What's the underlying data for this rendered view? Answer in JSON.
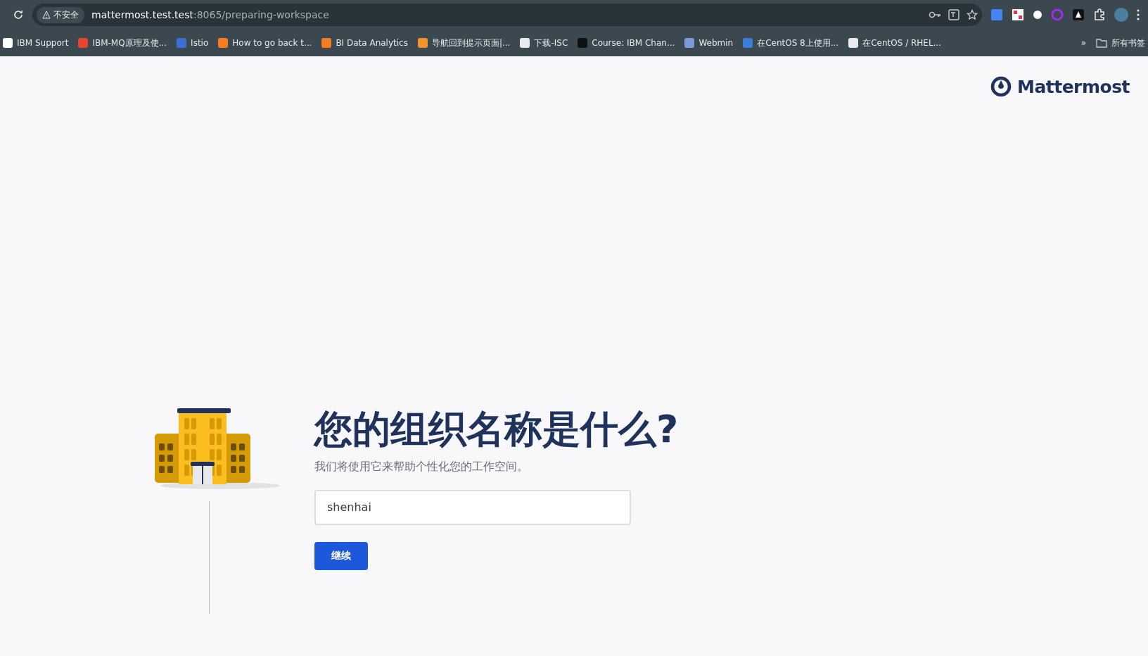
{
  "browser": {
    "security_label": "不安全",
    "url_host": "mattermost.test.test",
    "url_path": ":8065/preparing-workspace",
    "bookmarks": [
      {
        "label": "IBM Support"
      },
      {
        "label": "IBM-MQ原理及使..."
      },
      {
        "label": "Istio"
      },
      {
        "label": "How to go back t..."
      },
      {
        "label": "BI Data Analytics"
      },
      {
        "label": "导航回到提示页面|..."
      },
      {
        "label": "下载-ISC"
      },
      {
        "label": "Course: IBM Chan..."
      },
      {
        "label": "Webmin"
      },
      {
        "label": "在CentOS 8上使用..."
      },
      {
        "label": "在CentOS / RHEL..."
      }
    ],
    "more_label": "»",
    "all_bookmarks": "所有书签"
  },
  "page": {
    "logo_text": "Mattermost",
    "heading": "您的组织名称是什么?",
    "subheading": "我们将使用它来帮助个性化您的工作空间。",
    "org_name": {
      "value": "shenhai"
    },
    "continue_button": "继续"
  }
}
